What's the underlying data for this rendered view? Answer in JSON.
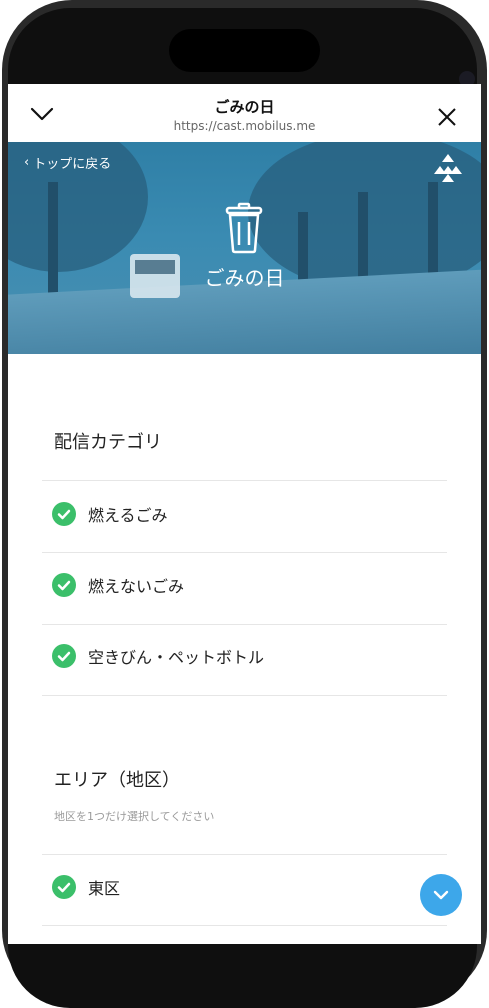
{
  "browser": {
    "title": "ごみの日",
    "url": "https://cast.mobilus.me"
  },
  "hero": {
    "back_label": "トップに戻る",
    "title": "ごみの日"
  },
  "sections": {
    "category_title": "配信カテゴリ",
    "categories": [
      "燃えるごみ",
      "燃えないごみ",
      "空きびん・ペットボトル"
    ],
    "area_title": "エリア（地区）",
    "area_helper": "地区を1つだけ選択してください",
    "areas": [
      "東区"
    ]
  },
  "colors": {
    "check": "#3bbf6a",
    "fab": "#3da7ea"
  }
}
